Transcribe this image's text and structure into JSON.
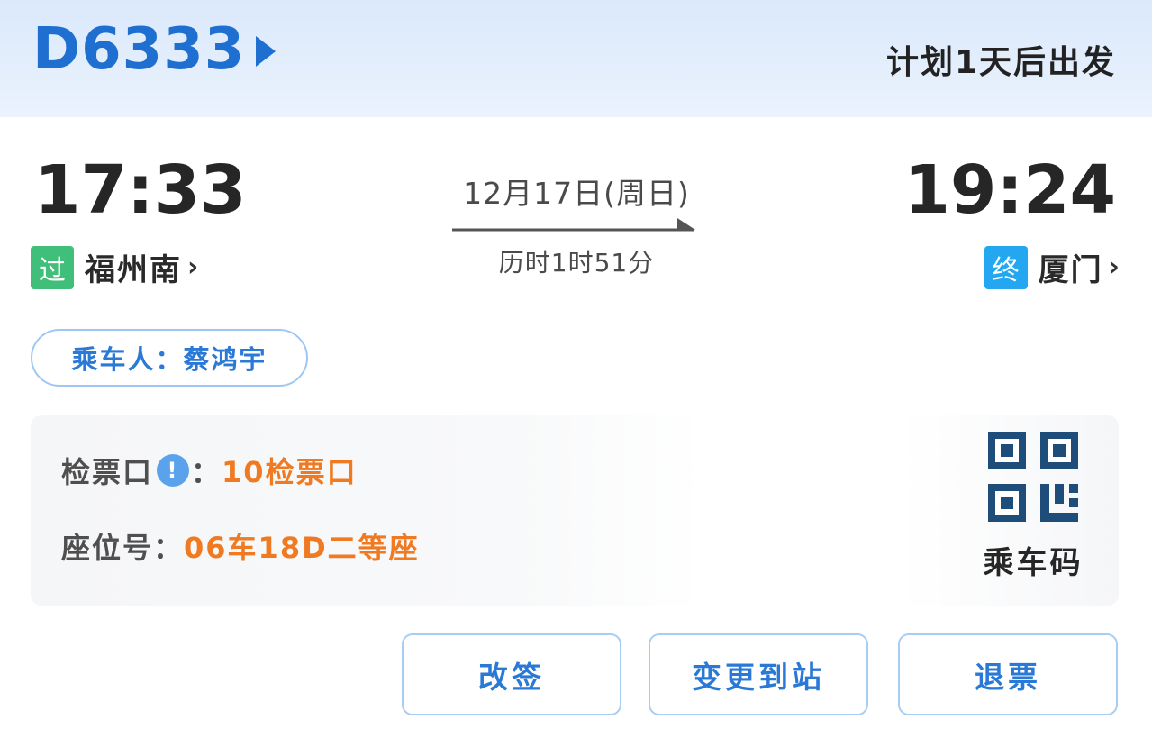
{
  "header": {
    "train_number": "D6333",
    "plan_text": "计划1天后出发"
  },
  "journey": {
    "departure_time": "17:33",
    "arrival_time": "19:24",
    "date": "12月17日(周日)",
    "duration": "历时1时51分",
    "from": {
      "badge": "过",
      "name": "福州南",
      "chevron": "›"
    },
    "to": {
      "badge": "终",
      "name": "厦门",
      "chevron": "›"
    }
  },
  "passenger": {
    "label": "乘车人：蔡鸿宇"
  },
  "info": {
    "gate_label": "检票口",
    "gate_colon": "：",
    "gate_value": "10检票口",
    "seat_label": "座位号：",
    "seat_value": "06车18D二等座",
    "alert_icon_glyph": "!"
  },
  "qr": {
    "label": "乘车码"
  },
  "actions": {
    "change": "改签",
    "reroute": "变更到站",
    "refund": "退票"
  },
  "colors": {
    "brand_blue": "#1f6fd1",
    "accent_orange": "#f07a22",
    "pass_badge": "#3fbf7a",
    "end_badge": "#23a7f1"
  }
}
